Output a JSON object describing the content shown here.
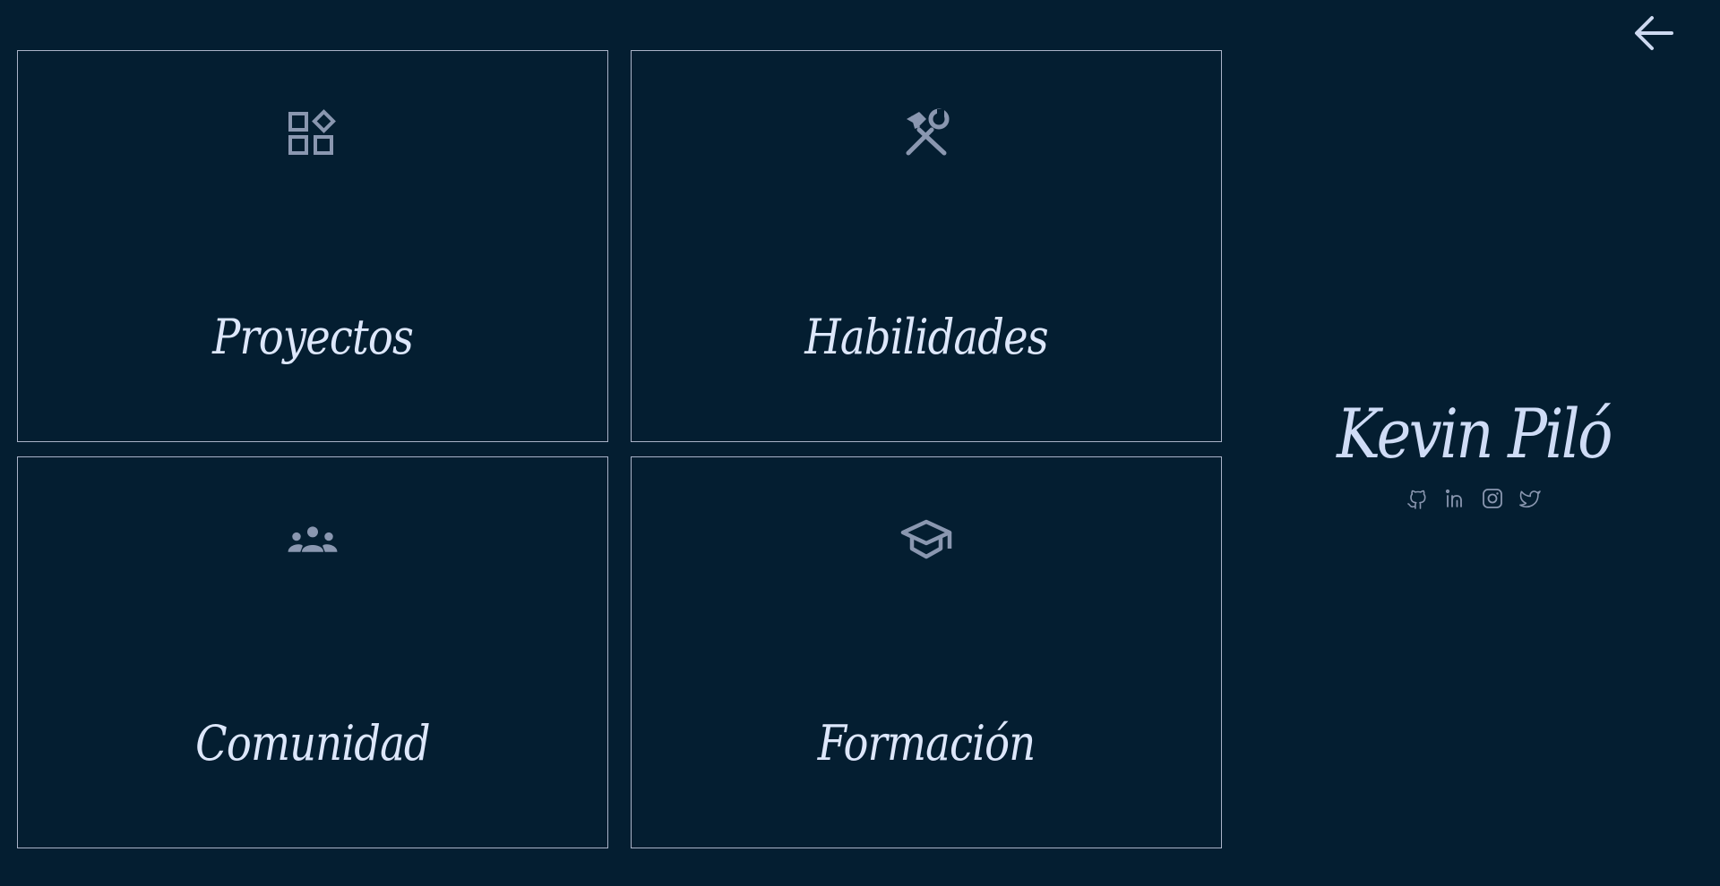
{
  "nav": {
    "back_icon": "arrow-left-icon"
  },
  "cards": [
    {
      "id": "proyectos",
      "title": "Proyectos",
      "icon": "apps-shapes-icon"
    },
    {
      "id": "habilidades",
      "title": "Habilidades",
      "icon": "tools-icon"
    },
    {
      "id": "comunidad",
      "title": "Comunidad",
      "icon": "people-group-icon"
    },
    {
      "id": "formacion",
      "title": "Formación",
      "icon": "graduation-cap-icon"
    }
  ],
  "profile": {
    "name": "Kevin Piló",
    "social": [
      {
        "name": "GitHub",
        "icon": "github-icon"
      },
      {
        "name": "LinkedIn",
        "icon": "linkedin-icon"
      },
      {
        "name": "Instagram",
        "icon": "instagram-icon"
      },
      {
        "name": "Twitter",
        "icon": "twitter-icon"
      }
    ]
  },
  "colors": {
    "background": "#041e31",
    "border": "#aab3c8",
    "icon": "#8a97b0",
    "text": "#dde7fb"
  }
}
